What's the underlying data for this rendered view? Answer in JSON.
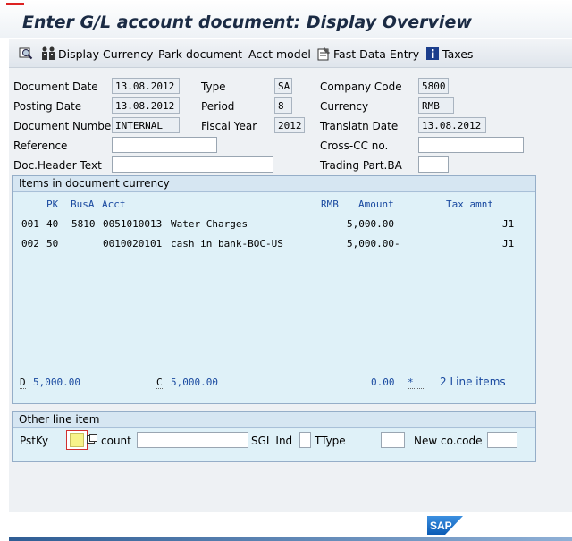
{
  "title": "Enter G/L account document: Display Overview",
  "toolbar": {
    "display_currency": "Display Currency",
    "park_document": "Park document",
    "acct_model": "Acct model",
    "fast_data_entry": "Fast Data Entry",
    "taxes": "Taxes"
  },
  "header": {
    "document_date_label": "Document Date",
    "document_date": "13.08.2012",
    "posting_date_label": "Posting Date",
    "posting_date": "13.08.2012",
    "document_number_label": "Document Number",
    "document_number": "INTERNAL",
    "reference_label": "Reference",
    "reference": "",
    "doc_header_text_label": "Doc.Header Text",
    "doc_header_text": "",
    "type_label": "Type",
    "type": "SA",
    "period_label": "Period",
    "period": "8",
    "fiscal_year_label": "Fiscal Year",
    "fiscal_year": "2012",
    "company_code_label": "Company Code",
    "company_code": "5800",
    "currency_label": "Currency",
    "currency": "RMB",
    "translatn_date_label": "Translatn Date",
    "translatn_date": "13.08.2012",
    "cross_cc_label": "Cross-CC no.",
    "cross_cc": "",
    "trading_part_label": "Trading Part.BA",
    "trading_part": ""
  },
  "items": {
    "group_title": "Items in document currency",
    "columns": {
      "pk": "PK",
      "busa": "BusA",
      "acct": "Acct",
      "curr": "RMB",
      "amount": "Amount",
      "tax_amnt": "Tax amnt"
    },
    "rows": [
      {
        "no": "001",
        "pk": "40",
        "busa": "5810",
        "acct": "0051010013",
        "text": "Water Charges",
        "amount": "5,000.00",
        "tax": "J1"
      },
      {
        "no": "002",
        "pk": "50",
        "busa": "",
        "acct": "0010020101",
        "text": "cash in bank-BOC-US",
        "amount": "5,000.00-",
        "tax": "J1"
      }
    ],
    "totals": {
      "d_label": "D",
      "d_value": "5,000.00",
      "c_label": "C",
      "c_value": "5,000.00",
      "balance": "0.00",
      "status": "*",
      "line_items": "2 Line items"
    }
  },
  "other": {
    "group_title": "Other line item",
    "pstky_label": "PstKy",
    "account_label": "count",
    "sgl_ind_label": "SGL Ind",
    "ttype_label": "TType",
    "new_co_code_label": "New co.code"
  },
  "logo_text": "SAP",
  "colors": {
    "sap_blue": "#0a5bb5",
    "title": "#1b2b44",
    "amount_blue": "#1a4aa0"
  }
}
